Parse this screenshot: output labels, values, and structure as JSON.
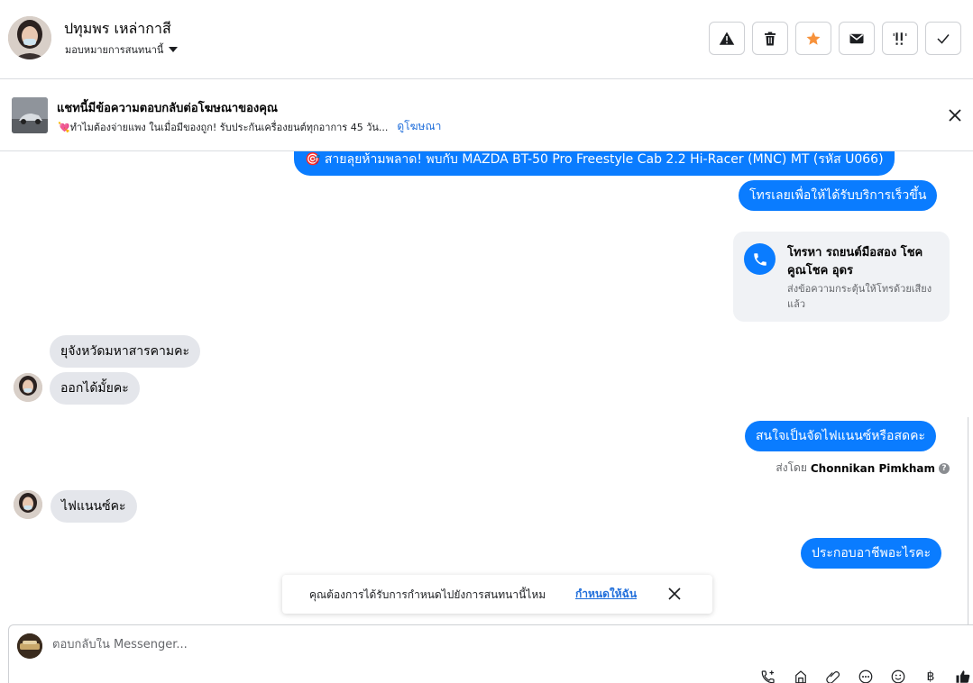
{
  "header": {
    "contact_name": "ปทุมพร เหล่ากาสี",
    "assign_label": "มอบหมายการสนทนานี้",
    "actions": [
      {
        "name": "spam",
        "icon": "warning-icon"
      },
      {
        "name": "delete",
        "icon": "trash-icon"
      },
      {
        "name": "star",
        "icon": "star-icon"
      },
      {
        "name": "mark-unread",
        "icon": "envelope-icon"
      },
      {
        "name": "follow-up",
        "icon": "follow-up-icon"
      },
      {
        "name": "done",
        "icon": "check-icon"
      }
    ]
  },
  "ad_banner": {
    "title": "แชทนี้มีข้อความตอบกลับต่อโฆษณาของคุณ",
    "snippet": "💘ทำไมต้องจ่ายแพง ในเมื่อมีของถูก! รับประกันเครื่องยนต์ทุกอาการ 45 วัน...",
    "link_label": "ดูโฆษณา"
  },
  "messages": {
    "out_1": "🎯 สายลุยห้ามพลาด! พบกับ MAZDA BT-50 Pro Freestyle Cab 2.2 Hi-Racer (MNC) MT (รหัส U066)",
    "out_2": "โทรเลยเพื่อให้ได้รับบริการเร็วขึ้น",
    "call_card": {
      "title": "โทรหา รถยนต์มือสอง โชคคูณโชค อุดร",
      "subtitle": "ส่งข้อความกระตุ้นให้โทรด้วยเสียงแล้ว"
    },
    "in_1": "ยุจังหวัดมหาสารคามคะ",
    "in_2": "ออกได้มั้ยคะ",
    "out_3": "สนใจเป็นจัดไฟแนนซ์หรือสดคะ",
    "sent_by_prefix": "ส่งโดย",
    "sent_by_name": "Chonnikan Pimkham",
    "in_3": "ไฟแนนซ์คะ",
    "out_4": "ประกอบอาชีพอะไรคะ"
  },
  "toast": {
    "text": "คุณต้องการได้รับการกำหนดไปยังการสนทนานี้ไหม",
    "link_label": "กำหนดให้ฉัน"
  },
  "composer": {
    "placeholder": "ตอบกลับใน Messenger...",
    "tools": [
      "call-add-icon",
      "saved-reply-icon",
      "attach-icon",
      "more-icon",
      "emoji-icon",
      "baht-icon",
      "like-icon"
    ]
  },
  "colors": {
    "accent": "#0a7cff",
    "link": "#216fdb",
    "incoming_bubble": "#e4e6eb",
    "star": "#f7923b"
  }
}
